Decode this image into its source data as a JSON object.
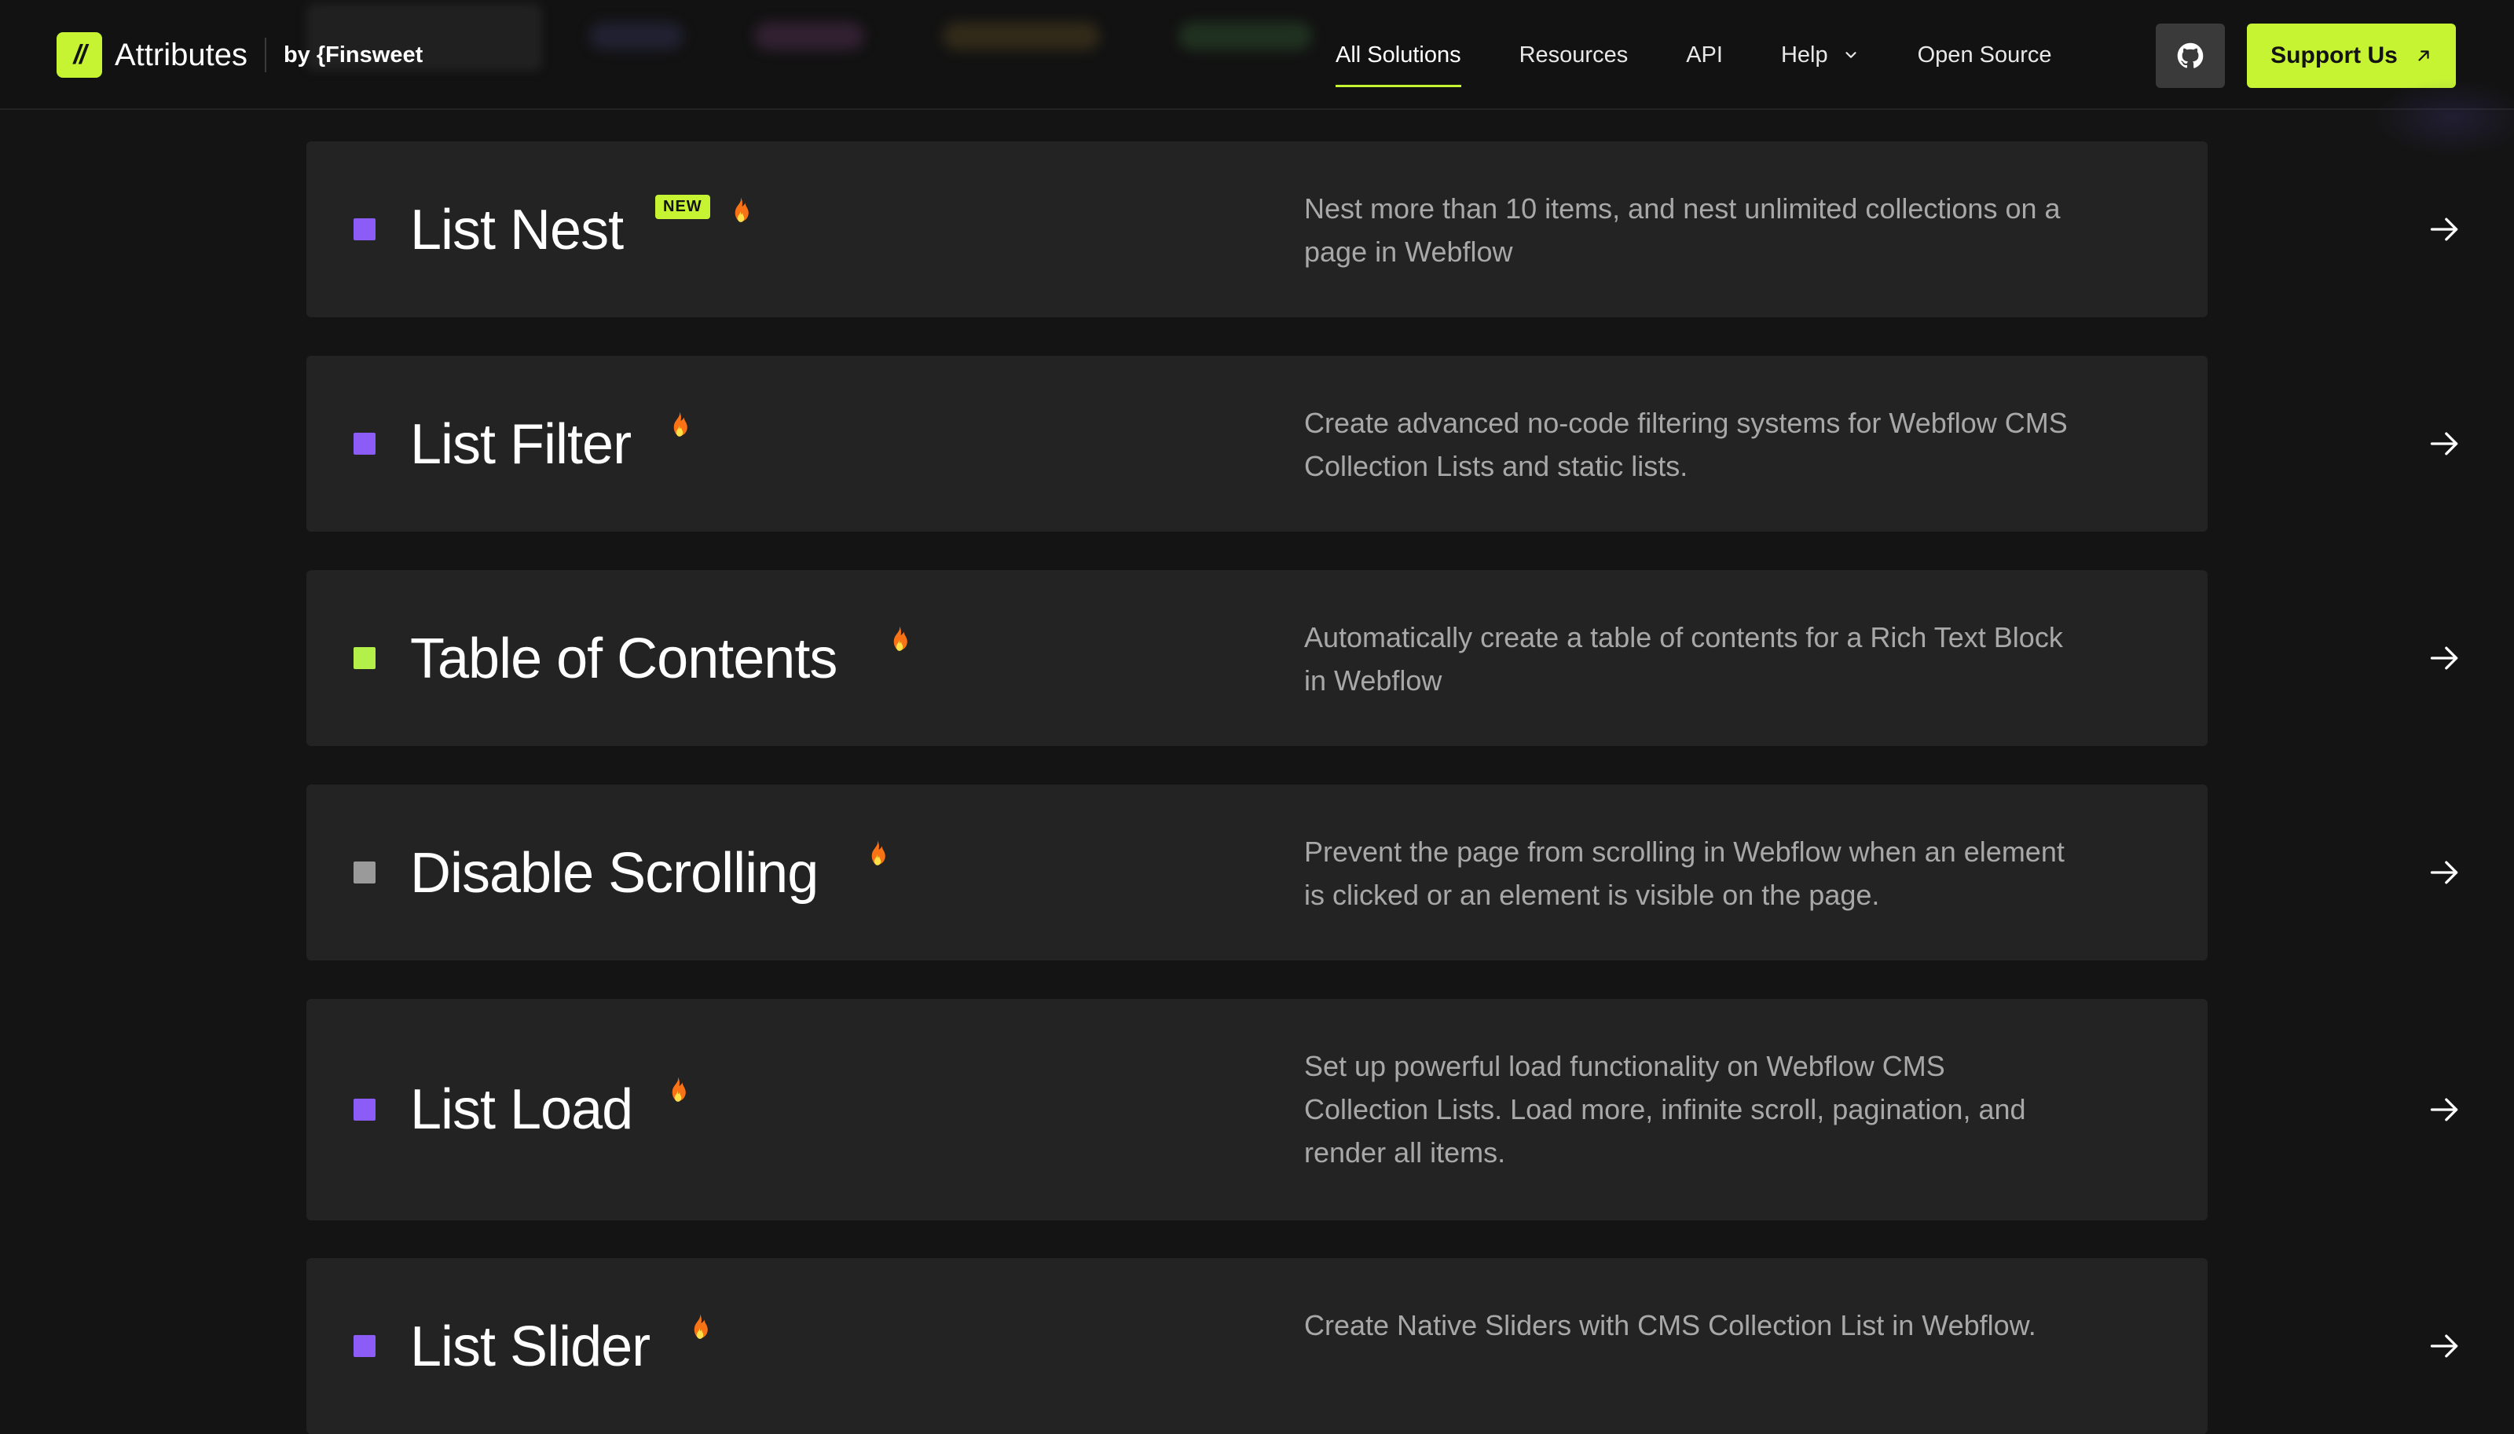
{
  "nav": {
    "logo_glyph": "//",
    "brand_name": "Attributes",
    "by_text": "by {Finsweet",
    "links": [
      {
        "label": "All Solutions",
        "active": true
      },
      {
        "label": "Resources"
      },
      {
        "label": "API"
      },
      {
        "label": "Help",
        "dropdown": true
      },
      {
        "label": "Open Source"
      }
    ],
    "github_icon": "github-icon",
    "support_label": "Support Us",
    "accent_color": "#c6f432"
  },
  "solutions": [
    {
      "title": "List Nest",
      "badge": "NEW",
      "hot": true,
      "color": "#8b5cf6",
      "description": "Nest more than 10 items, and nest unlimited collections on a page in Webflow"
    },
    {
      "title": "List Filter",
      "hot": true,
      "color": "#8b5cf6",
      "description": "Create advanced no-code filtering systems for Webflow CMS Collection Lists and static lists."
    },
    {
      "title": "Table of Contents",
      "hot": true,
      "color": "#b4f04a",
      "description": "Automatically create a table of contents for a Rich Text Block in Webflow"
    },
    {
      "title": "Disable Scrolling",
      "hot": true,
      "color": "#9a9a9a",
      "description": "Prevent the page from scrolling in Webflow when an element is clicked or an element is visible on the page."
    },
    {
      "title": "List Load",
      "hot": true,
      "color": "#8b5cf6",
      "description": "Set up powerful load functionality on Webflow CMS Collection Lists. Load more, infinite scroll, pagination, and render all items."
    },
    {
      "title": "List Slider",
      "hot": true,
      "color": "#8b5cf6",
      "description": "Create Native Sliders with CMS Collection List in Webflow."
    }
  ]
}
